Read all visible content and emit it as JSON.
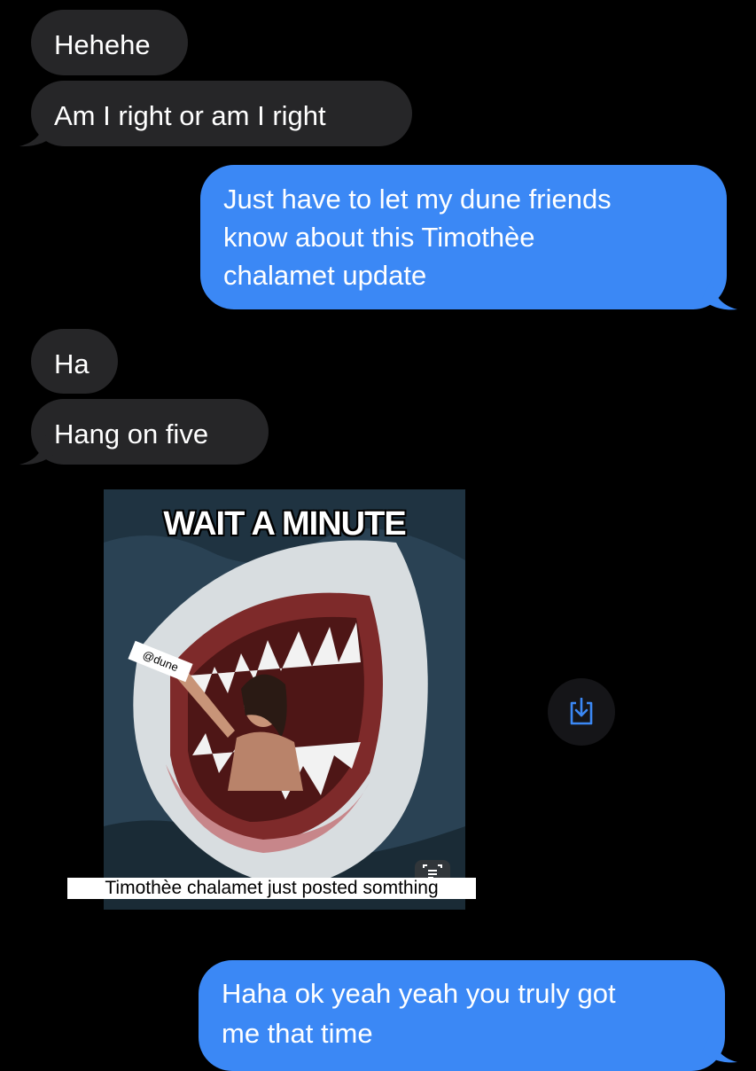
{
  "messages": [
    {
      "side": "received",
      "text": "Hehehe"
    },
    {
      "side": "received",
      "text": "Am I right or am I right"
    },
    {
      "side": "sent",
      "lines": [
        "Just have to let my dune friends",
        "know about this Timothèe",
        "chalamet update"
      ]
    },
    {
      "side": "received",
      "text": "Ha"
    },
    {
      "side": "received",
      "text": "Hang on five"
    },
    {
      "side": "sent",
      "lines": [
        "Haha ok yeah yeah you truly got",
        "me that time"
      ]
    }
  ],
  "image_message": {
    "meme_top_text": "WAIT A MINUTE",
    "tag_text": "@dune",
    "caption": "Timothèe chalamet just posted somthing"
  },
  "icons": {
    "save": "save-to-photos-icon",
    "live_text": "live-text-icon"
  },
  "colors": {
    "background": "#000000",
    "received_bubble": "#262628",
    "sent_bubble": "#3b88f5",
    "save_icon": "#3b88f5"
  }
}
